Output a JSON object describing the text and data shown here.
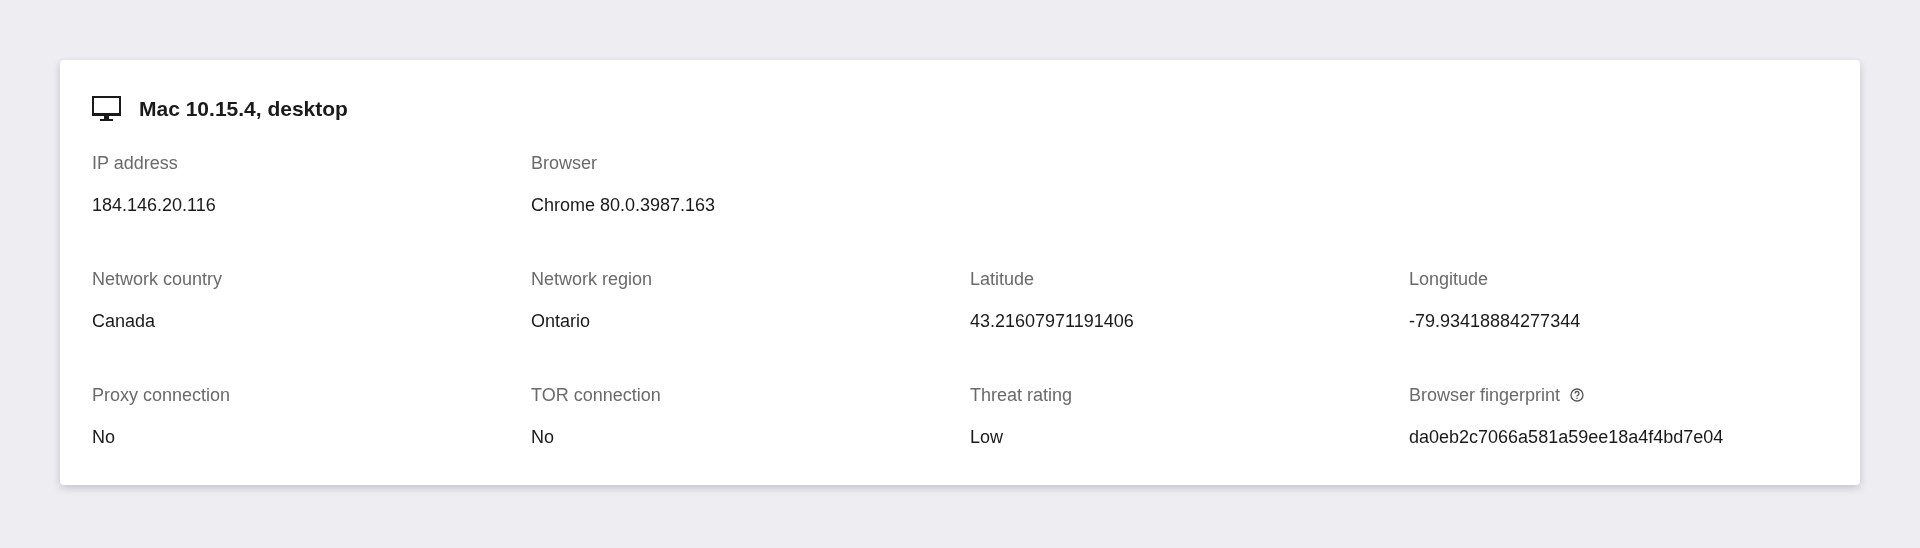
{
  "device": {
    "title": "Mac 10.15.4, desktop"
  },
  "rows": [
    [
      {
        "label": "IP address",
        "value": "184.146.20.116"
      },
      {
        "label": "Browser",
        "value": "Chrome 80.0.3987.163"
      }
    ],
    [
      {
        "label": "Network country",
        "value": "Canada"
      },
      {
        "label": "Network region",
        "value": "Ontario"
      },
      {
        "label": "Latitude",
        "value": "43.21607971191406"
      },
      {
        "label": "Longitude",
        "value": "-79.93418884277344"
      }
    ],
    [
      {
        "label": "Proxy connection",
        "value": "No"
      },
      {
        "label": "TOR connection",
        "value": "No"
      },
      {
        "label": "Threat rating",
        "value": "Low"
      },
      {
        "label": "Browser fingerprint",
        "value": "da0eb2c7066a581a59ee18a4f4bd7e04",
        "help": true
      }
    ]
  ]
}
